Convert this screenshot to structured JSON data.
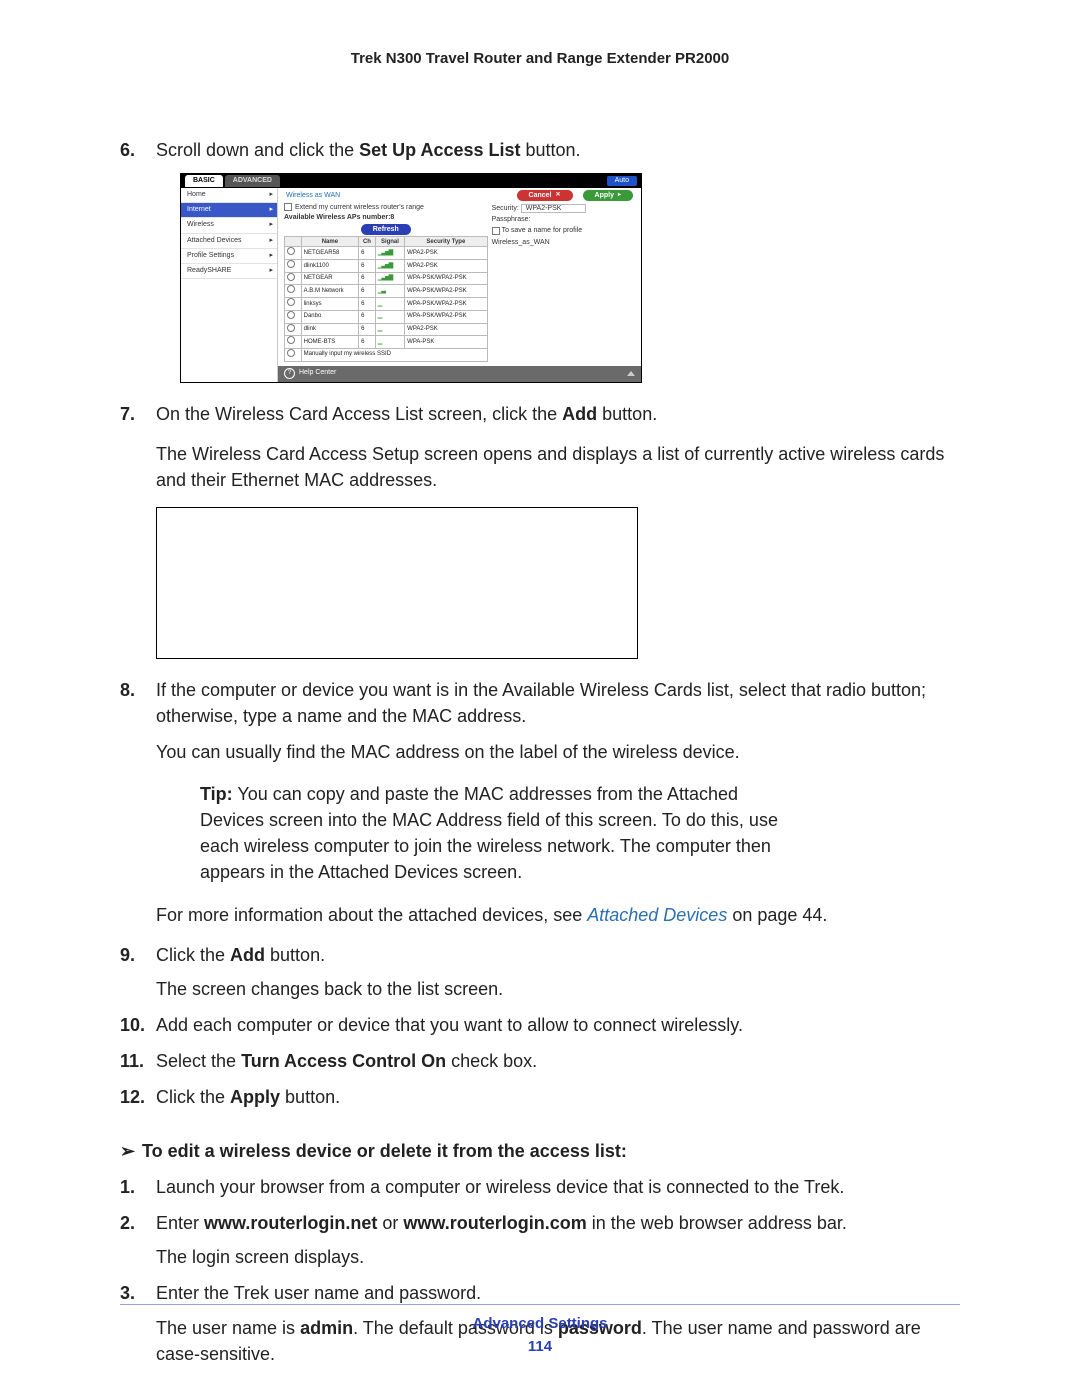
{
  "header": {
    "title": "Trek N300 Travel Router and Range Extender PR2000"
  },
  "footer": {
    "label": "Advanced Settings",
    "page": "114"
  },
  "steps_a": {
    "n6": {
      "num": "6.",
      "pre": "Scroll down and click the ",
      "bold": "Set Up Access List",
      "post": " button."
    },
    "n7": {
      "num": "7.",
      "pre": "On the Wireless Card Access List screen, click the ",
      "bold": "Add",
      "post": " button."
    },
    "n7b": "The Wireless Card Access Setup screen opens and displays a list of currently active wireless cards and their Ethernet MAC addresses.",
    "n8": {
      "num": "8.",
      "text": "If the computer or device you want is in the Available Wireless Cards list, select that radio button; otherwise, type a name and the MAC address."
    },
    "n8b": "You can usually find the MAC address on the label of the wireless device.",
    "tip": {
      "label": "Tip:",
      "text": " You can copy and paste the MAC addresses from the Attached Devices screen into the MAC Address field of this screen. To do this, use each wireless computer to join the wireless network. The computer then appears in the Attached Devices screen."
    },
    "n8c": {
      "pre": "For more information about the attached devices, see ",
      "link": "Attached Devices",
      "post": " on page 44."
    },
    "n9": {
      "num": "9.",
      "pre": "Click the ",
      "bold": "Add",
      "post": " button."
    },
    "n9b": "The screen changes back to the list screen.",
    "n10": {
      "num": "10.",
      "text": "Add each computer or device that you want to allow to connect wirelessly."
    },
    "n11": {
      "num": "11.",
      "pre": "Select the ",
      "bold": "Turn Access Control On",
      "post": " check box."
    },
    "n12": {
      "num": "12.",
      "pre": "Click the ",
      "bold": "Apply",
      "post": " button."
    }
  },
  "sub": {
    "arrow": "➢",
    "text": "To edit a wireless device or delete it from the access list:"
  },
  "steps_b": {
    "n1": {
      "num": "1.",
      "text": "Launch your browser from a computer or wireless device that is connected to the Trek."
    },
    "n2": {
      "num": "2.",
      "pre": "Enter ",
      "b1": "www.routerlogin.net",
      "mid": " or ",
      "b2": "www.routerlogin.com",
      "post": " in the web browser address bar."
    },
    "n2b": "The login screen displays.",
    "n3": {
      "num": "3.",
      "text": "Enter the Trek user name and password."
    },
    "n3b": {
      "p0": "The user name is ",
      "b1": "admin",
      "p1": ". The default password is ",
      "b2": "password",
      "p2": ". The user name and password are case-sensitive."
    }
  },
  "ui": {
    "tabs": {
      "basic": "BASIC",
      "advanced": "ADVANCED"
    },
    "auto_select": "Auto",
    "side": {
      "home": "Home",
      "internet": "Internet",
      "wireless": "Wireless",
      "attached": "Attached Devices",
      "profile": "Profile Settings",
      "ready": "ReadySHARE"
    },
    "title": "Wireless as WAN",
    "buttons": {
      "cancel": "Cancel",
      "apply": "Apply",
      "refresh": "Refresh"
    },
    "extend": "Extend my current wireless router's range",
    "ap_label": "Available Wireless APs number:8",
    "table": {
      "headers": {
        "sel": "",
        "name": "Name",
        "ch": "Ch",
        "sig": "Signal",
        "sec": "Security Type"
      },
      "rows": [
        {
          "name": "NETGEAR58",
          "ch": "6",
          "sig": "▁▃▅▇",
          "sec": "WPA2-PSK"
        },
        {
          "name": "dlink1100",
          "ch": "6",
          "sig": "▁▃▅▇",
          "sec": "WPA2-PSK"
        },
        {
          "name": "NETGEAR",
          "ch": "6",
          "sig": "▁▃▅▇",
          "sec": "WPA-PSK/WPA2-PSK"
        },
        {
          "name": "A.B.M Network",
          "ch": "6",
          "sig": "▁▃",
          "sec": "WPA-PSK/WPA2-PSK"
        },
        {
          "name": "linksys",
          "ch": "6",
          "sig": "▁",
          "sec": "WPA-PSK/WPA2-PSK"
        },
        {
          "name": "Danbo",
          "ch": "6",
          "sig": "▁",
          "sec": "WPA-PSK/WPA2-PSK"
        },
        {
          "name": "dlink",
          "ch": "6",
          "sig": "▁",
          "sec": "WPA2-PSK"
        },
        {
          "name": "HOME-BTS",
          "ch": "6",
          "sig": "▁",
          "sec": "WPA-PSK"
        }
      ],
      "manual": "Manually input my wireless SSID"
    },
    "right": {
      "security_label": "Security:",
      "security_value": "WPA2-PSK",
      "passphrase": "Passphrase:",
      "save_cb": "To save a name for profile",
      "profile": "Wireless_as_WAN"
    },
    "help": "Help Center"
  }
}
